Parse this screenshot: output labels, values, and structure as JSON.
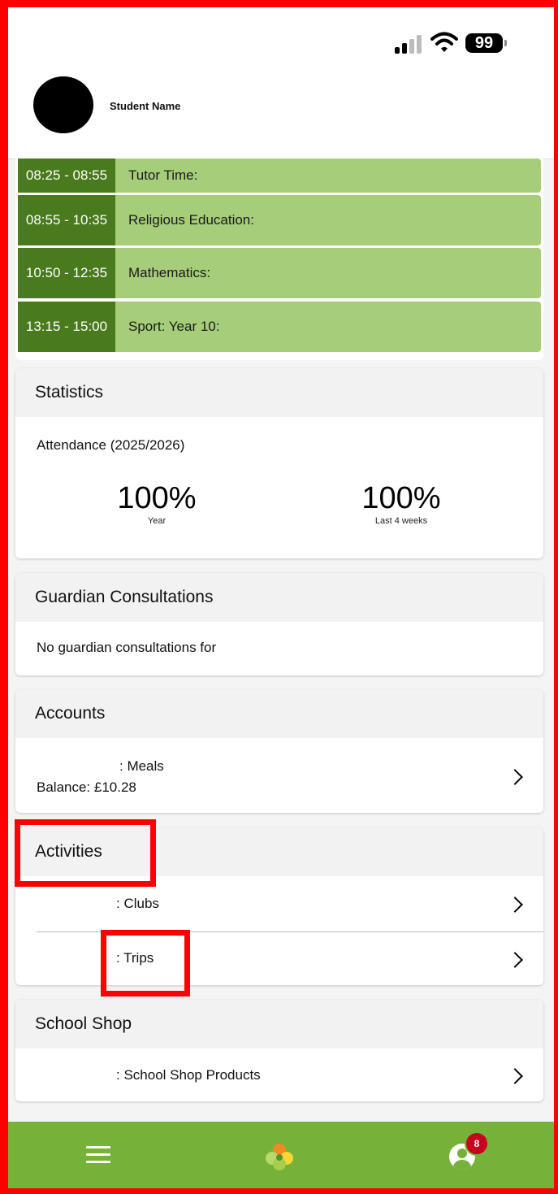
{
  "status_bar": {
    "battery": "99"
  },
  "header": {
    "student_name": "Student Name"
  },
  "timetable": [
    {
      "time": "08:25 - 08:55",
      "subject": "Tutor Time:"
    },
    {
      "time": "08:55 - 10:35",
      "subject": "Religious Education:"
    },
    {
      "time": "10:50 - 12:35",
      "subject": "Mathematics:"
    },
    {
      "time": "13:15 - 15:00",
      "subject": "Sport: Year 10:"
    }
  ],
  "statistics": {
    "title": "Statistics",
    "caption": "Attendance (2025/2026)",
    "year_value": "100%",
    "year_label": "Year",
    "weeks_value": "100%",
    "weeks_label": "Last 4 weeks"
  },
  "guardian": {
    "title": "Guardian Consultations",
    "text": "No guardian consultations for"
  },
  "accounts": {
    "title": "Accounts",
    "meals_label": ": Meals",
    "balance": "Balance: £10.28"
  },
  "activities": {
    "title": "Activities",
    "clubs_label": ": Clubs",
    "trips_label": ": Trips"
  },
  "school_shop": {
    "title": "School Shop",
    "products_label": ": School Shop Products"
  },
  "bottom_nav": {
    "notification_count": "8",
    "icons": [
      "menu-icon",
      "app-logo-icon",
      "profile-icon"
    ]
  },
  "colors": {
    "brand_green": "#76b13a",
    "time_green": "#4a7a1e",
    "row_green": "#a5cd7a",
    "badge_red": "#c8001e",
    "highlight_red": "#ff0000"
  }
}
